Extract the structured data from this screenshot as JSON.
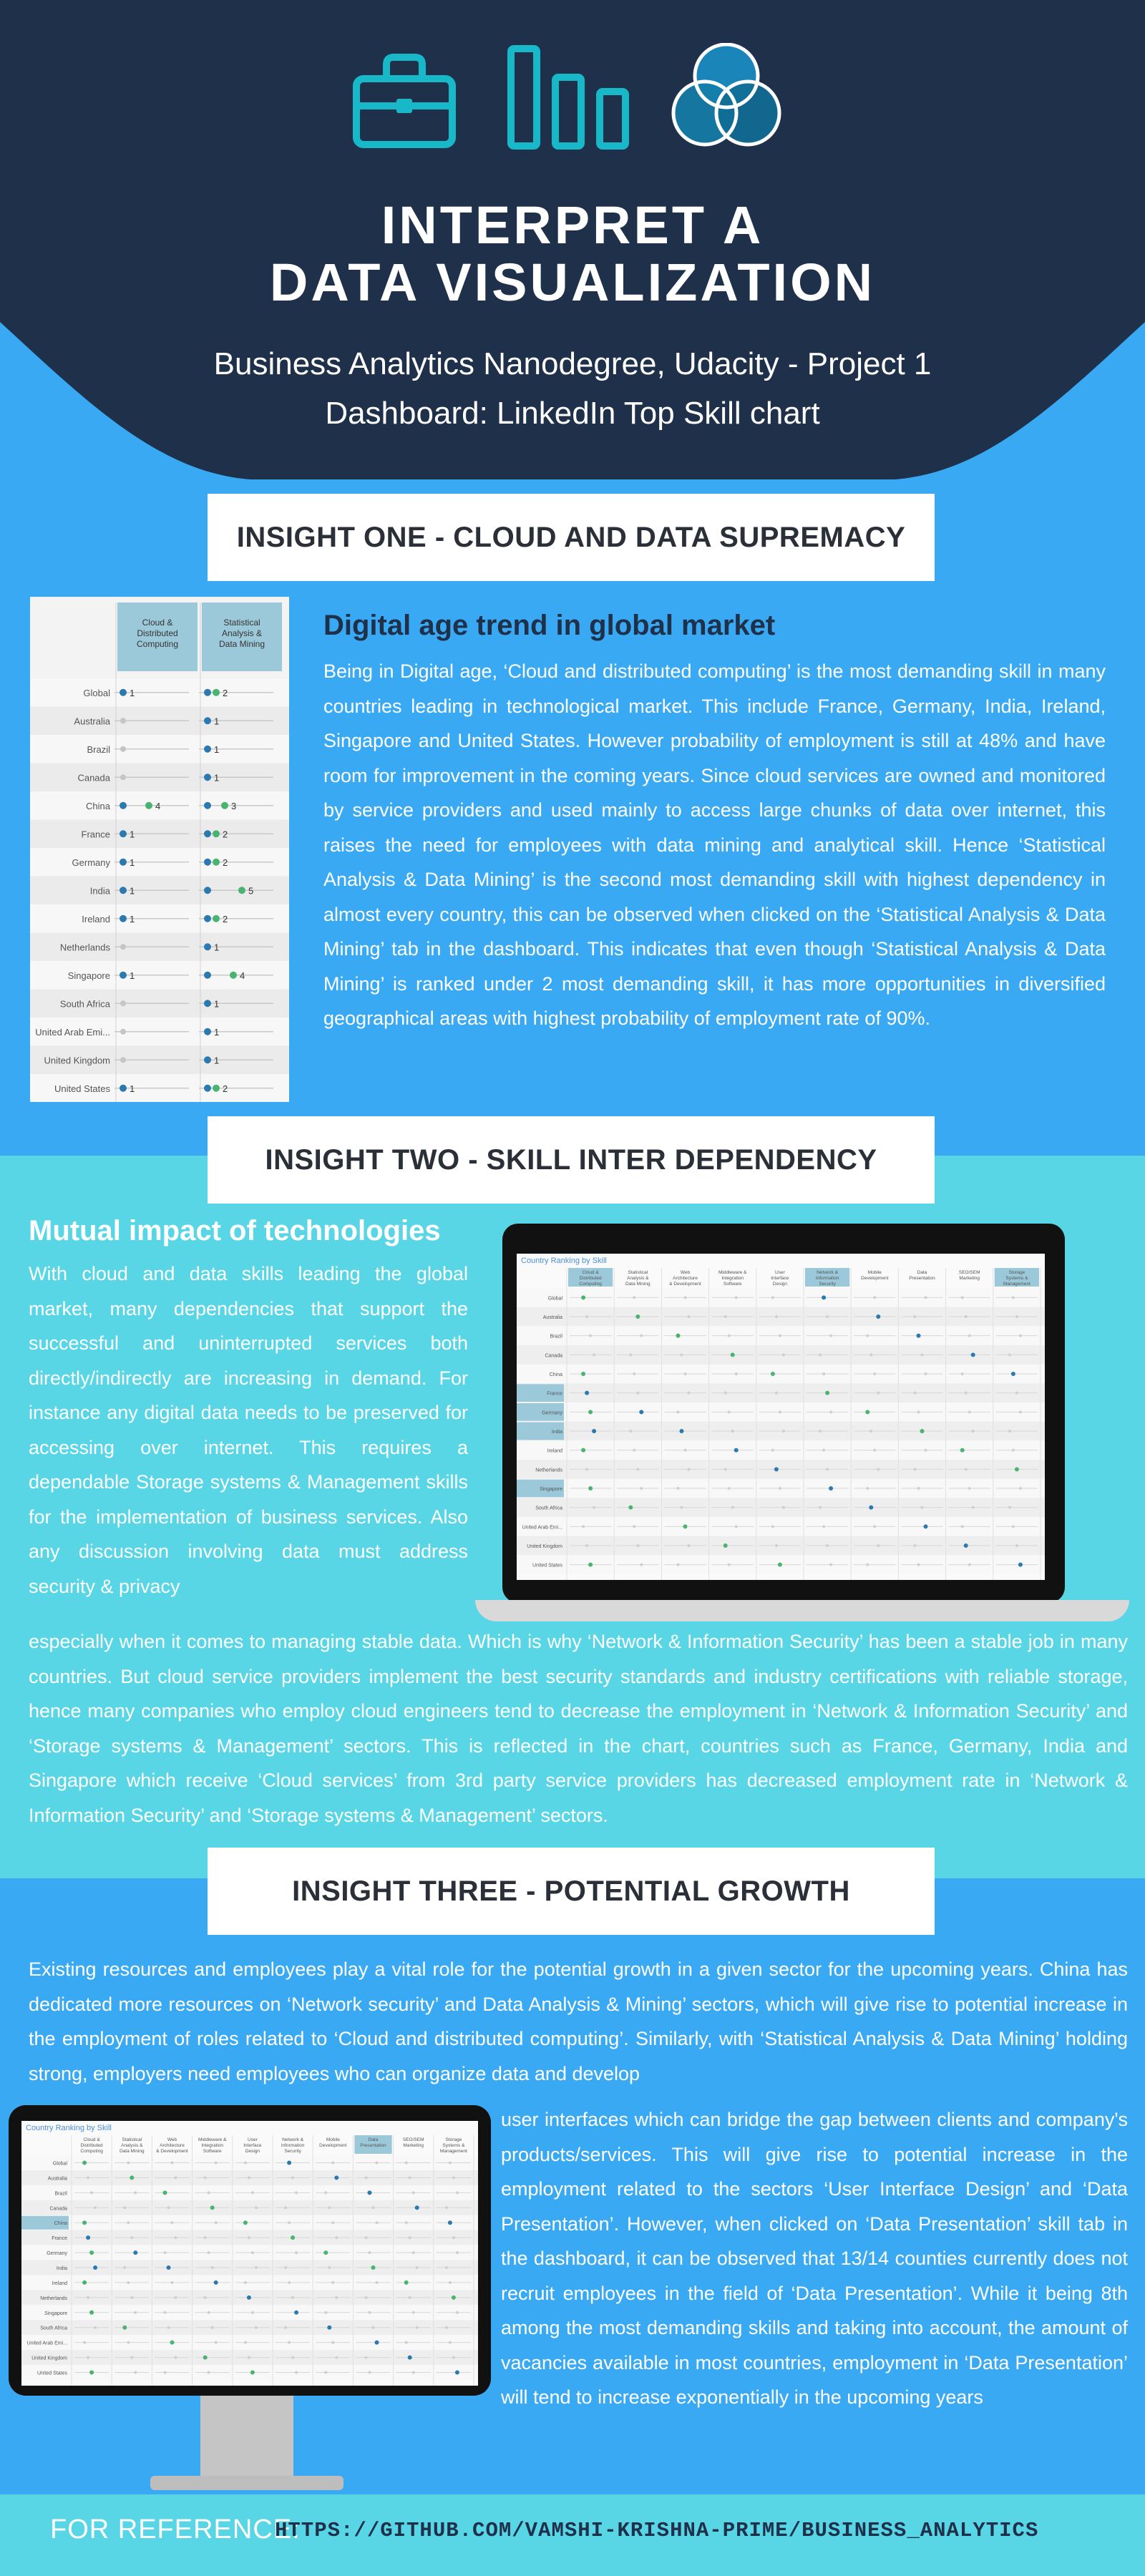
{
  "header": {
    "title_line1": "INTERPRET A",
    "title_line2": "DATA VISUALIZATION",
    "subtitle_line1": "Business Analytics Nanodegree, Udacity - Project 1",
    "subtitle_line2": "Dashboard: LinkedIn Top Skill chart",
    "icons": [
      "briefcase-icon",
      "bar-chart-icon",
      "venn-diagram-icon"
    ]
  },
  "colors": {
    "navy": "#1f304a",
    "blue": "#3aa9f4",
    "cyan": "#58d6e6",
    "teal_icon": "#18b8c9",
    "white": "#ffffff"
  },
  "insight1": {
    "banner": "INSIGHT ONE - CLOUD AND DATA SUPREMACY",
    "heading": "Digital age trend in global market",
    "paragraph": "Being in Digital age, ‘Cloud and distributed computing’ is the most demanding skill in many countries leading in technological market. This include France, Germany, India, Ireland, Singapore and United States. However probability of employment is still at 48% and have room for improvement in the coming years. Since cloud services are owned and monitored by service providers and used mainly to access large chunks of data over internet, this raises the need for employees with data mining and analytical skill. Hence ‘Statistical Analysis & Data Mining’ is the second most demanding skill with highest dependency in almost every country, this can be observed when clicked on the ‘Statistical Analysis & Data Mining’ tab in the dashboard. This indicates that even though ‘Statistical Analysis & Data Mining’ is ranked under 2 most demanding skill, it has more opportunities in diversified geographical areas with highest probability of employment rate of 90%.",
    "table": {
      "columns": [
        "Cloud & Distributed Computing",
        "Statistical Analysis & Data Mining"
      ],
      "rows": [
        {
          "country": "Global",
          "c1": "1",
          "c2": "2"
        },
        {
          "country": "Australia",
          "c1": "",
          "c2": "1"
        },
        {
          "country": "Brazil",
          "c1": "",
          "c2": "1"
        },
        {
          "country": "Canada",
          "c1": "",
          "c2": "1"
        },
        {
          "country": "China",
          "c1": "4",
          "c2": "3"
        },
        {
          "country": "France",
          "c1": "1",
          "c2": "2"
        },
        {
          "country": "Germany",
          "c1": "1",
          "c2": "2"
        },
        {
          "country": "India",
          "c1": "1",
          "c2": "5"
        },
        {
          "country": "Ireland",
          "c1": "1",
          "c2": "2"
        },
        {
          "country": "Netherlands",
          "c1": "",
          "c2": "1"
        },
        {
          "country": "Singapore",
          "c1": "1",
          "c2": "4"
        },
        {
          "country": "South Africa",
          "c1": "",
          "c2": "1"
        },
        {
          "country": "United Arab Emi...",
          "c1": "",
          "c2": "1"
        },
        {
          "country": "United Kingdom",
          "c1": "",
          "c2": "1"
        },
        {
          "country": "United States",
          "c1": "1",
          "c2": "2"
        }
      ]
    }
  },
  "insight2": {
    "banner": "INSIGHT TWO - SKILL INTER DEPENDENCY",
    "heading": "Mutual impact of technologies",
    "paragraph_left": "With cloud and data skills leading the global market, many dependencies that support the successful and uninterrupted services both directly/indirectly are increasing in demand. For instance any digital data needs to be preserved for accessing over internet. This requires a dependable Storage systems & Management skills for the implementation of business services. Also any discussion involving data must address security & privacy",
    "paragraph_full": "especially when it comes to managing stable data. Which is why ‘Network & Information Security’ has been a stable job in many countries. But cloud service providers implement the best security standards and industry certifications with reliable storage, hence many companies who employ cloud engineers tend to decrease the employment in ‘Network & Information Security’ and ‘Storage systems & Management’ sectors. This is reflected in the chart, countries such as France, Germany, India and Singapore which receive ‘Cloud services’ from 3rd party service providers has decreased employment rate in ‘Network & Information Security’ and ‘Storage systems & Management’ sectors.",
    "screen_title": "Country Ranking by Skill",
    "screen_columns": [
      "Cloud & Distributed Computing",
      "Statistical Analysis & Data Mining",
      "Web Architecture & Development Framework",
      "Middleware & Integration Software",
      "User Interface Design",
      "Network & Information Security",
      "Mobile Development",
      "Data Presentation",
      "SEO/SEM Marketing",
      "Storage Systems & Management"
    ],
    "screen_countries": [
      "Global",
      "Australia",
      "Brazil",
      "Canada",
      "China",
      "France",
      "Germany",
      "India",
      "Ireland",
      "Netherlands",
      "Singapore",
      "South Africa",
      "United Arab Emi...",
      "United Kingdom",
      "United States"
    ]
  },
  "insight3": {
    "banner": "INSIGHT THREE - POTENTIAL GROWTH",
    "paragraph_full": "Existing resources and employees play a vital role for the potential growth in a given sector for the upcoming years. China has dedicated more resources on ‘Network security’ and Data Analysis & Mining’ sectors, which will give rise to potential increase in the employment of roles related to ‘Cloud and distributed computing’. Similarly, with ‘Statistical Analysis & Data Mining’ holding strong, employers need employees who can organize data and develop",
    "paragraph_right": "user interfaces which can bridge the gap between clients and company's products/services. This will give rise to potential increase in the employment related to the sectors ‘User Interface Design’ and ‘Data Presentation’. However, when clicked on ‘Data Presentation’ skill tab in the dashboard, it can be observed that 13/14 counties currently does not recruit employees in the field of ‘Data Presentation’. While it being 8th among the most demanding skills and taking into account, the amount of vacancies available in most countries, employment in ‘Data Presentation’ will tend to increase exponentially in the upcoming years",
    "screen_title": "Country Ranking by Skill"
  },
  "footer": {
    "label": "FOR REFERENCE:",
    "link": "HTTPS://GITHUB.COM/VAMSHI-KRISHNA-PRIME/BUSINESS_ANALYTICS"
  }
}
